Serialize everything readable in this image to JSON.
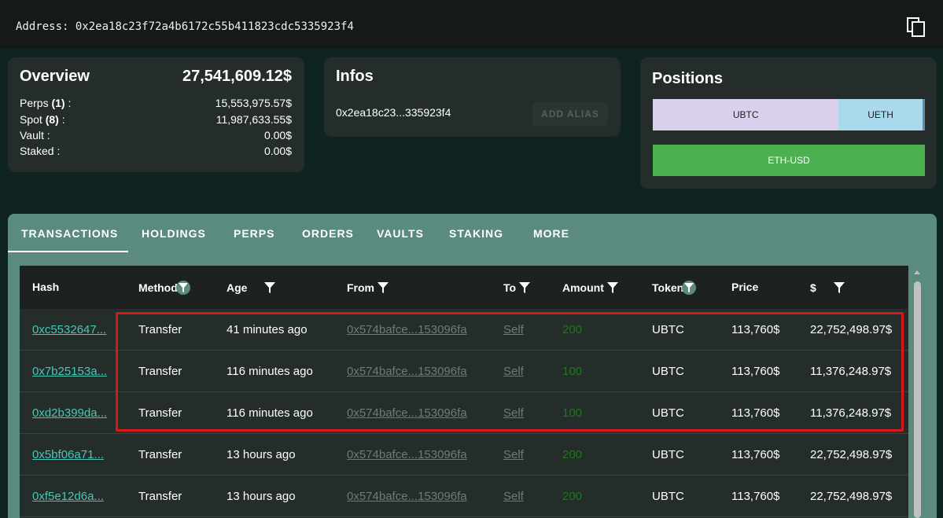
{
  "address": {
    "label": "Address:",
    "value": "0x2ea18c23f72a4b6172c55b411823cdc5335923f4"
  },
  "overview": {
    "title": "Overview",
    "total": "27,541,609.12$",
    "rows": [
      {
        "label_pre": "Perps ",
        "count": "(1)",
        "label_post": " :",
        "value": "15,553,975.57$"
      },
      {
        "label_pre": "Spot ",
        "count": "(8)",
        "label_post": " :",
        "value": "11,987,633.55$"
      },
      {
        "label_pre": "Vault :",
        "count": "",
        "label_post": "",
        "value": "0.00$"
      },
      {
        "label_pre": "Staked :",
        "count": "",
        "label_post": "",
        "value": "0.00$"
      }
    ]
  },
  "infos": {
    "title": "Infos",
    "short_address": "0x2ea18c23...335923f4",
    "add_alias_label": "ADD ALIAS"
  },
  "positions": {
    "title": "Positions",
    "bar": [
      {
        "label": "UBTC",
        "share": 0.683,
        "color": "#d9d0eb"
      },
      {
        "label": "UETH",
        "share": 0.308,
        "color": "#a9d9ea"
      },
      {
        "label": "",
        "share": 0.009,
        "color": "#5b8fb0"
      }
    ],
    "eth_usd": {
      "label": "ETH-USD",
      "color": "#4caf50"
    }
  },
  "tabs": [
    "TRANSACTIONS",
    "HOLDINGS",
    "PERPS",
    "ORDERS",
    "VAULTS",
    "STAKING",
    "MORE"
  ],
  "active_tab": "TRANSACTIONS",
  "table": {
    "columns": [
      "Hash",
      "Method",
      "Age",
      "From",
      "To",
      "Amount",
      "Token",
      "Price",
      "$"
    ],
    "rows": [
      {
        "hash": "0xc5532647...",
        "method": "Transfer",
        "age": "41 minutes ago",
        "from": "0x574bafce...153096fa",
        "to": "Self",
        "amount": "200",
        "token": "UBTC",
        "price": "113,760$",
        "usd": "22,752,498.97$"
      },
      {
        "hash": "0x7b25153a...",
        "method": "Transfer",
        "age": "116 minutes ago",
        "from": "0x574bafce...153096fa",
        "to": "Self",
        "amount": "100",
        "token": "UBTC",
        "price": "113,760$",
        "usd": "11,376,248.97$"
      },
      {
        "hash": "0xd2b399da...",
        "method": "Transfer",
        "age": "116 minutes ago",
        "from": "0x574bafce...153096fa",
        "to": "Self",
        "amount": "100",
        "token": "UBTC",
        "price": "113,760$",
        "usd": "11,376,248.97$"
      },
      {
        "hash": "0x5bf06a71...",
        "method": "Transfer",
        "age": "13 hours ago",
        "from": "0x574bafce...153096fa",
        "to": "Self",
        "amount": "200",
        "token": "UBTC",
        "price": "113,760$",
        "usd": "22,752,498.97$"
      },
      {
        "hash": "0xf5e12d6a...",
        "method": "Transfer",
        "age": "13 hours ago",
        "from": "0x574bafce...153096fa",
        "to": "Self",
        "amount": "200",
        "token": "UBTC",
        "price": "113,760$",
        "usd": "22,752,498.97$"
      }
    ]
  },
  "colors": {
    "background": "#0f2420",
    "card": "#252d2b",
    "tab_bar": "#5b8a7e",
    "hash_link": "#45c8b4",
    "amount_green": "#1a7a1a",
    "highlight_red": "#d61a1a"
  }
}
